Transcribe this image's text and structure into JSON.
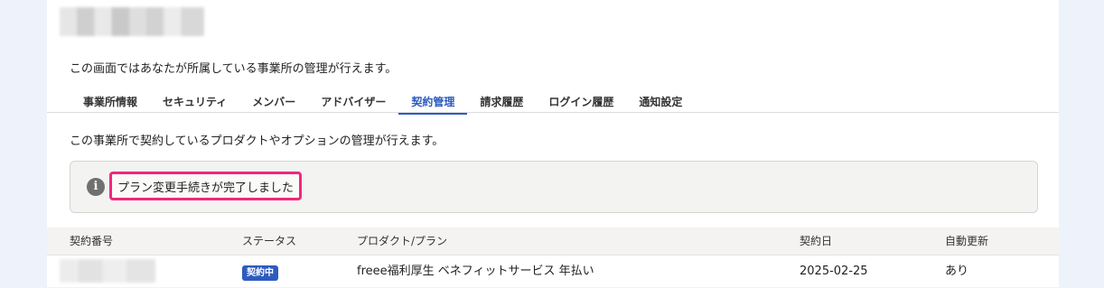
{
  "intro": "この画面ではあなたが所属している事業所の管理が行えます。",
  "tabs": [
    {
      "label": "事業所情報"
    },
    {
      "label": "セキュリティ"
    },
    {
      "label": "メンバー"
    },
    {
      "label": "アドバイザー"
    },
    {
      "label": "契約管理"
    },
    {
      "label": "請求履歴"
    },
    {
      "label": "ログイン履歴"
    },
    {
      "label": "通知設定"
    }
  ],
  "active_tab": "契約管理",
  "section": {
    "description": "この事業所で契約しているプロダクトやオプションの管理が行えます。",
    "notice": "プラン変更手続きが完了しました",
    "notice_icon": "info-icon"
  },
  "table": {
    "headers": {
      "number": "契約番号",
      "status": "ステータス",
      "product": "プロダクト/プラン",
      "date": "契約日",
      "renew": "自動更新"
    },
    "rows": [
      {
        "status": "契約中",
        "product": "freee福利厚生 ベネフィットサービス 年払い",
        "date": "2025-02-25",
        "renew": "あり"
      }
    ]
  },
  "colors": {
    "accent": "#2e5bbf",
    "highlight": "#f2277a",
    "background": "#eef2fb"
  }
}
